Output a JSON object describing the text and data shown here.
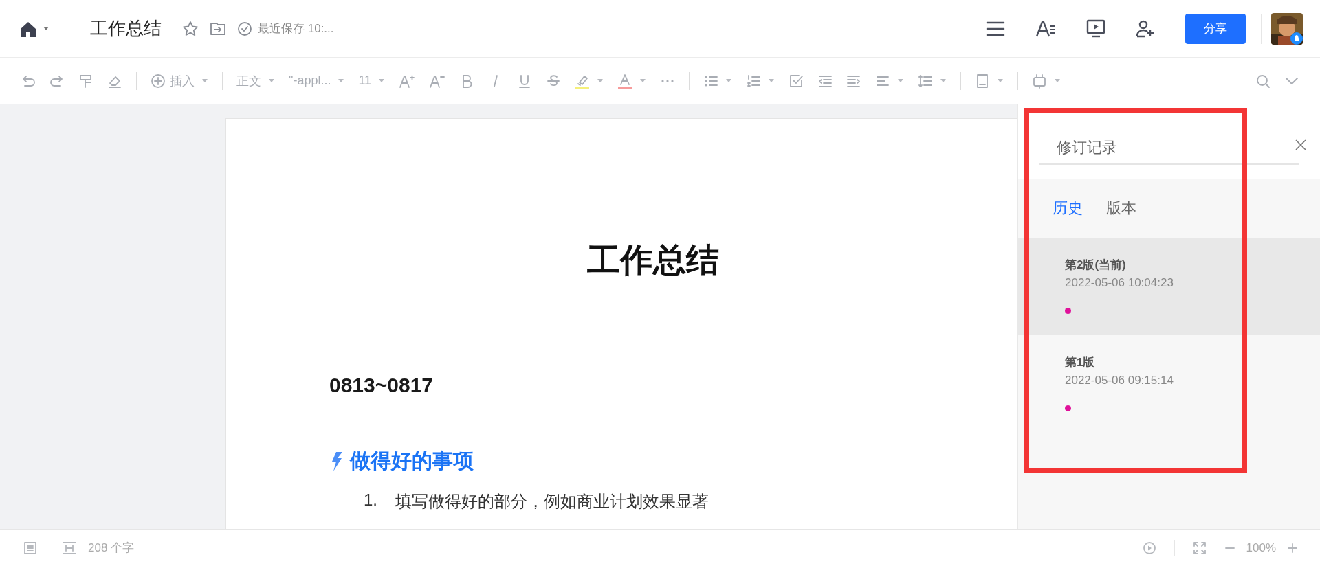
{
  "top_bar": {
    "title": "工作总结",
    "save_status": "最近保存 10:...",
    "share_button": "分享"
  },
  "toolbar": {
    "insert": "插入",
    "paragraph_style": "正文",
    "font": "\"-appl...",
    "font_size": "11"
  },
  "document": {
    "title": "工作总结",
    "date_range": "0813~0817",
    "section_heading": "做得好的事项",
    "list_items": [
      {
        "number": "1.",
        "text": "填写做得好的部分，例如商业计划效果显著"
      }
    ]
  },
  "revision_panel": {
    "title": "修订记录",
    "tabs": [
      {
        "label": "历史",
        "selected": true
      },
      {
        "label": "版本",
        "selected": false
      }
    ],
    "versions": [
      {
        "name": "第2版(当前)",
        "time": "2022-05-06 10:04:23",
        "selected": true
      },
      {
        "name": "第1版",
        "time": "2022-05-06 09:15:14",
        "selected": false
      }
    ]
  },
  "status_bar": {
    "word_count": "208 个字",
    "zoom": "100%"
  }
}
